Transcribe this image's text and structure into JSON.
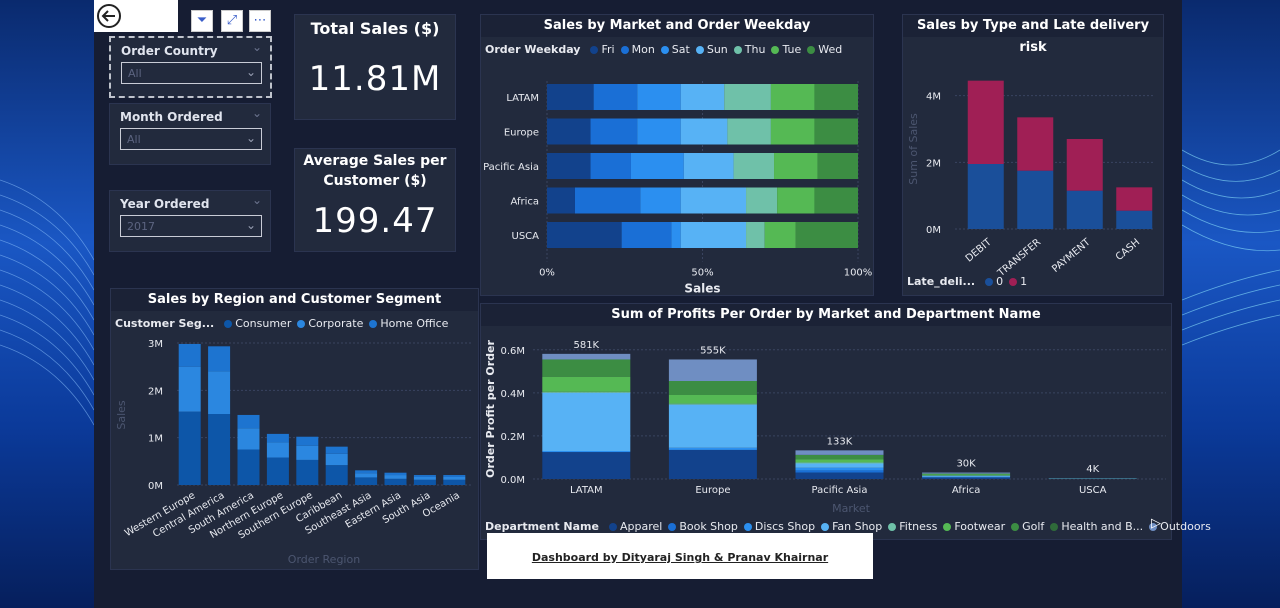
{
  "colors": {
    "fri": "#12428c",
    "mon": "#1a6fd6",
    "sat": "#2b8ff0",
    "sun": "#57b2f5",
    "thu": "#6fc1a9",
    "tue": "#55b954",
    "wed": "#3c8d43",
    "late0": "#1a4f9a",
    "late1": "#a01f55",
    "consumer": "#0d56a8",
    "corporate": "#2b87e0",
    "home": "#1d74d0"
  },
  "slicers": [
    {
      "label": "Order Country",
      "value": "All"
    },
    {
      "label": "Month Ordered",
      "value": "All"
    },
    {
      "label": "Year Ordered",
      "value": "2017"
    }
  ],
  "kpis": {
    "total_title": "Total Sales ($)",
    "total_value": "11.81M",
    "avg_title": "Average Sales per Customer ($)",
    "avg_value": "199.47"
  },
  "credit": "Dashboard by Dityaraj Singh & Pranav Khairnar",
  "chart_data": [
    {
      "type": "bar",
      "orientation": "horizontal-stacked-100",
      "title": "Sales by Market and Order Weekday",
      "legend_title": "Order Weekday",
      "xlabel": "Sales",
      "x_ticks": [
        "0%",
        "50%",
        "100%"
      ],
      "categories": [
        "LATAM",
        "Europe",
        "Pacific Asia",
        "Africa",
        "USCA"
      ],
      "series": [
        {
          "name": "Fri",
          "color_key": "fri",
          "values": [
            15,
            14,
            14,
            9,
            24
          ]
        },
        {
          "name": "Mon",
          "color_key": "mon",
          "values": [
            14,
            15,
            13,
            21,
            16
          ]
        },
        {
          "name": "Sat",
          "color_key": "sat",
          "values": [
            14,
            14,
            17,
            13,
            3
          ]
        },
        {
          "name": "Sun",
          "color_key": "sun",
          "values": [
            14,
            15,
            16,
            21,
            21
          ]
        },
        {
          "name": "Thu",
          "color_key": "thu",
          "values": [
            15,
            14,
            13,
            10,
            6
          ]
        },
        {
          "name": "Tue",
          "color_key": "tue",
          "values": [
            14,
            14,
            14,
            12,
            10
          ]
        },
        {
          "name": "Wed",
          "color_key": "wed",
          "values": [
            14,
            14,
            13,
            14,
            20
          ]
        }
      ]
    },
    {
      "type": "bar",
      "orientation": "vertical-stacked",
      "title": "Sales by Type and Late delivery risk",
      "legend_title": "Late_deli...",
      "ylabel": "Sum of Sales",
      "y_ticks": [
        "0M",
        "2M",
        "4M"
      ],
      "ylim": [
        0,
        4.8
      ],
      "categories": [
        "DEBIT",
        "TRANSFER",
        "PAYMENT",
        "CASH"
      ],
      "series": [
        {
          "name": "0",
          "color_key": "late0",
          "values": [
            1.95,
            1.75,
            1.15,
            0.55
          ]
        },
        {
          "name": "1",
          "color_key": "late1",
          "values": [
            2.5,
            1.6,
            1.55,
            0.7
          ]
        }
      ]
    },
    {
      "type": "bar",
      "orientation": "vertical-stacked",
      "title": "Sales by Region and Customer Segment",
      "legend_title": "Customer Seg...",
      "xlabel": "Order Region",
      "ylabel": "Sales",
      "y_ticks": [
        "0M",
        "1M",
        "2M",
        "3M"
      ],
      "ylim": [
        0,
        3
      ],
      "categories": [
        "Western Europe",
        "Central America",
        "South America",
        "Northern Europe",
        "Southern Europe",
        "Caribbean",
        "Southeast Asia",
        "Eastern Asia",
        "South Asia",
        "Oceania"
      ],
      "series": [
        {
          "name": "Consumer",
          "color_key": "consumer",
          "values": [
            1.55,
            1.5,
            0.75,
            0.58,
            0.53,
            0.42,
            0.16,
            0.13,
            0.11,
            0.11
          ]
        },
        {
          "name": "Corporate",
          "color_key": "corporate",
          "values": [
            0.95,
            0.9,
            0.45,
            0.32,
            0.3,
            0.24,
            0.09,
            0.08,
            0.06,
            0.06
          ]
        },
        {
          "name": "Home Office",
          "color_key": "home",
          "values": [
            0.48,
            0.53,
            0.28,
            0.18,
            0.19,
            0.15,
            0.06,
            0.05,
            0.04,
            0.04
          ]
        }
      ]
    },
    {
      "type": "bar",
      "orientation": "vertical-stacked",
      "title": "Sum of Profits Per Order by Market and Department Name",
      "legend_title": "Department Name",
      "xlabel": "Market",
      "ylabel": "Order Profit per Order",
      "y_ticks": [
        "0.0M",
        "0.2M",
        "0.4M",
        "0.6M"
      ],
      "ylim": [
        0,
        0.65
      ],
      "categories": [
        "LATAM",
        "Europe",
        "Pacific Asia",
        "Africa",
        "USCA"
      ],
      "totals": [
        "581K",
        "555K",
        "133K",
        "30K",
        "4K"
      ],
      "series": [
        {
          "name": "Apparel",
          "color": "#12428c",
          "values": [
            0.125,
            0.135,
            0.03,
            0.006,
            0.0008
          ]
        },
        {
          "name": "Book Shop",
          "color": "#1a6fd6",
          "values": [
            0.0,
            0.0,
            0.01,
            0.002,
            0.0003
          ]
        },
        {
          "name": "Discs Shop",
          "color": "#2b8ff0",
          "values": [
            0.005,
            0.01,
            0.012,
            0.002,
            0.0003
          ]
        },
        {
          "name": "Fan Shop",
          "color": "#57b2f5",
          "values": [
            0.27,
            0.2,
            0.02,
            0.005,
            0.0008
          ]
        },
        {
          "name": "Fitness",
          "color": "#6fc1a9",
          "values": [
            0.005,
            0.005,
            0.005,
            0.002,
            0.0003
          ]
        },
        {
          "name": "Footwear",
          "color": "#55b954",
          "values": [
            0.07,
            0.04,
            0.015,
            0.004,
            0.0005
          ]
        },
        {
          "name": "Golf",
          "color": "#3c8d43",
          "values": [
            0.08,
            0.065,
            0.02,
            0.004,
            0.0005
          ]
        },
        {
          "name": "Health and B...",
          "color": "#2f6b3a",
          "values": [
            0.0,
            0.0,
            0.0,
            0.0,
            0.0
          ]
        },
        {
          "name": "Outdoors",
          "color": "#6f8ec2",
          "values": [
            0.026,
            0.1,
            0.021,
            0.005,
            0.0005
          ]
        }
      ]
    }
  ]
}
